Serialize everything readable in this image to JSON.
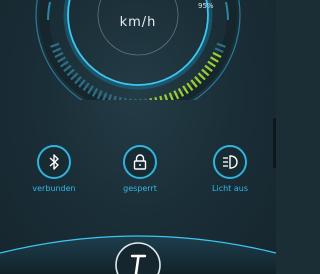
{
  "speedometer": {
    "unit": "km/h",
    "battery_percent_text": "95%",
    "battery_level": 0.95
  },
  "controls": {
    "bluetooth": {
      "label": "verbunden",
      "icon": "bluetooth-icon"
    },
    "lock": {
      "label": "gesperrt",
      "icon": "lock-icon"
    },
    "light": {
      "label": "Licht aus",
      "icon": "headlight-icon"
    }
  },
  "kickstand": {
    "icon": "kickstand-icon"
  },
  "colors": {
    "accent": "#32b8e6",
    "bar_inactive": "#2e6f86",
    "bar_active": "#9acd32",
    "background": "#1b2d35"
  }
}
